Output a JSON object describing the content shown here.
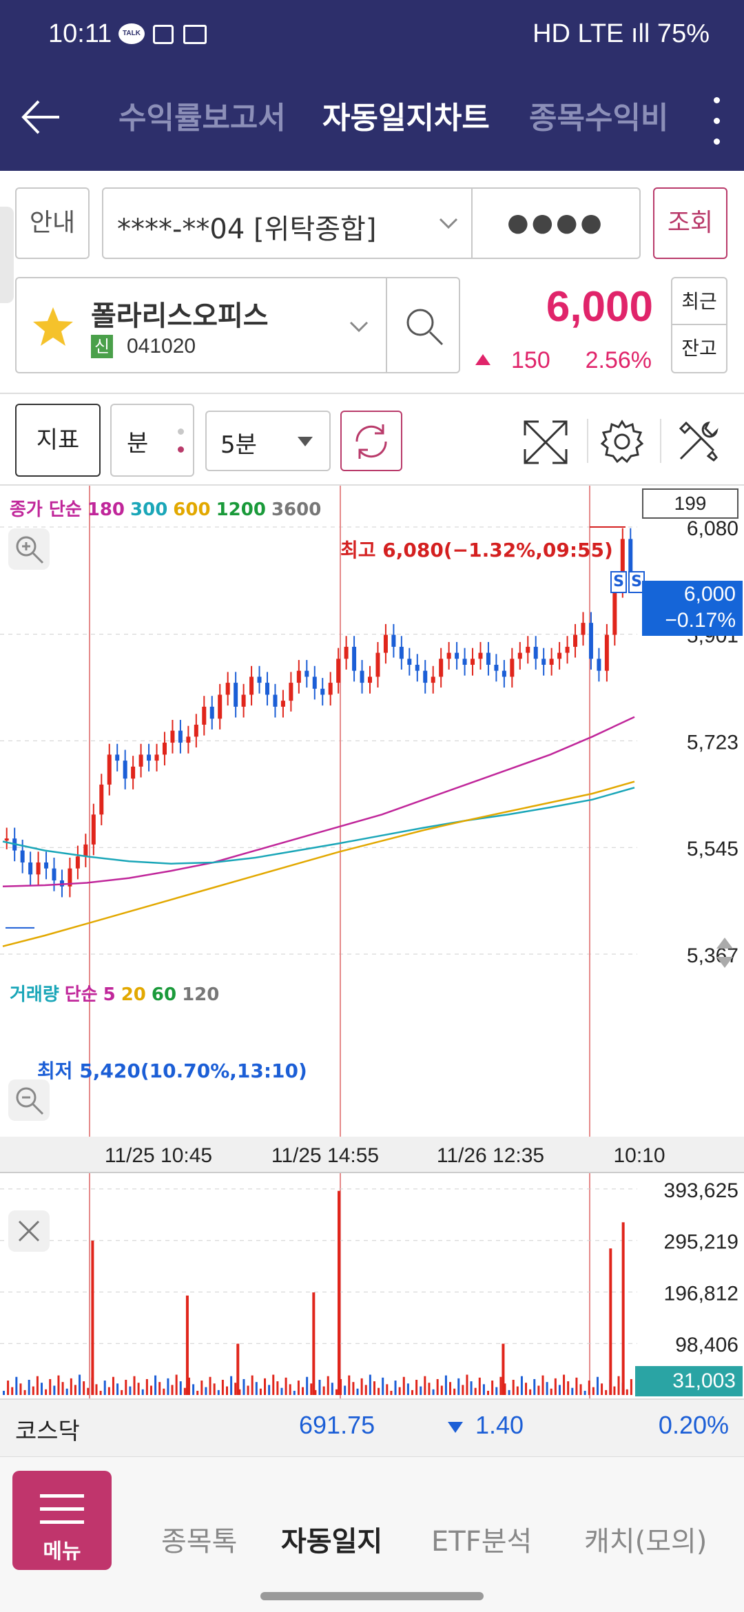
{
  "status_bar": {
    "time": "10:11",
    "right": "HD LTE ıll 75%",
    "battery": "75%"
  },
  "app_bar": {
    "tabs": [
      {
        "label": "수익률보고서",
        "active": false
      },
      {
        "label": "자동일지차트",
        "active": true
      },
      {
        "label": "종목수익비",
        "active": false
      }
    ]
  },
  "form": {
    "guide_label": "안내",
    "account": "****-**04 [위탁종합]",
    "password": "●●●●",
    "query_label": "조회",
    "stock_name": "폴라리스오피스",
    "stock_tag": "신",
    "stock_code": "041020",
    "recent_label": "최근",
    "balance_label": "잔고",
    "price": "6,000",
    "change": "150",
    "change_pct": "2.56%"
  },
  "toolbar": {
    "indicator_label": "지표",
    "minute_label": "분",
    "interval": "5분"
  },
  "chart_meta": {
    "legend": [
      {
        "text": "종가 단순",
        "color": "#c0269a"
      },
      {
        "text": "180",
        "color": "#c0269a"
      },
      {
        "text": "300",
        "color": "#1aa6b8"
      },
      {
        "text": "600",
        "color": "#e2a800"
      },
      {
        "text": "1200",
        "color": "#1a9a3a"
      },
      {
        "text": "3600",
        "color": "#777777"
      }
    ],
    "count_box": "199",
    "high_label": "최고 6,080(−1.32%,09:55)",
    "low_label": "최저 5,420(10.70%,13:10)",
    "price_tag_line1": "6,000",
    "price_tag_line2": "−0.17%",
    "signal_marker": "S",
    "x_labels": [
      "11/25 10:45",
      "11/25 14:55",
      "11/26 12:35",
      "10:10"
    ],
    "vol_legend": [
      {
        "text": "거래량",
        "color": "#1aa6b8"
      },
      {
        "text": "단순",
        "color": "#c0269a"
      },
      {
        "text": "5",
        "color": "#c0269a"
      },
      {
        "text": "20",
        "color": "#e2a800"
      },
      {
        "text": "60",
        "color": "#1a9a3a"
      },
      {
        "text": "120",
        "color": "#777777"
      }
    ],
    "vol_axis": [
      "393,625",
      "295,219",
      "196,812",
      "98,406"
    ],
    "vol_current": "31,003",
    "colors": {
      "up": "#e0251b",
      "down": "#1b5ed6",
      "session_line": "#e58a8a",
      "tag_blue": "#1565d8",
      "tag_teal": "#2aa4a4"
    }
  },
  "chart_data": {
    "type": "candlestick",
    "y_ticks": [
      6080,
      5901,
      5723,
      5545,
      5367
    ],
    "ylim": [
      5367,
      6080
    ],
    "high": 6080,
    "low": 5420,
    "current": 6000,
    "price_series": [
      5560,
      5540,
      5520,
      5500,
      5520,
      5510,
      5490,
      5480,
      5510,
      5530,
      5550,
      5600,
      5650,
      5700,
      5690,
      5660,
      5680,
      5700,
      5690,
      5700,
      5720,
      5740,
      5720,
      5730,
      5750,
      5780,
      5760,
      5800,
      5820,
      5780,
      5800,
      5830,
      5820,
      5800,
      5780,
      5790,
      5820,
      5840,
      5830,
      5810,
      5800,
      5820,
      5860,
      5880,
      5840,
      5820,
      5830,
      5870,
      5900,
      5880,
      5860,
      5850,
      5840,
      5820,
      5830,
      5860,
      5870,
      5860,
      5850,
      5860,
      5870,
      5850,
      5840,
      5830,
      5860,
      5870,
      5880,
      5860,
      5850,
      5860,
      5870,
      5880,
      5900,
      5920,
      5860,
      5840,
      5900,
      5980,
      6060,
      6000
    ],
    "ma_series": [
      {
        "name": "180",
        "color": "#c0269a",
        "values": [
          5480,
          5482,
          5486,
          5494,
          5506,
          5520,
          5540,
          5560,
          5580,
          5600,
          5625,
          5650,
          5675,
          5700,
          5730,
          5763
        ]
      },
      {
        "name": "300",
        "color": "#1aa6b8",
        "values": [
          5555,
          5540,
          5530,
          5522,
          5518,
          5520,
          5528,
          5540,
          5552,
          5565,
          5578,
          5590,
          5600,
          5612,
          5625,
          5645
        ]
      },
      {
        "name": "600",
        "color": "#e2a800",
        "values": [
          5380,
          5398,
          5418,
          5438,
          5458,
          5478,
          5498,
          5518,
          5538,
          5556,
          5574,
          5590,
          5605,
          5620,
          5635,
          5655
        ]
      }
    ],
    "volume": {
      "axis_ticks": [
        393625,
        295219,
        196812,
        98406
      ],
      "current": 31003,
      "spikes": [
        {
          "pos": 0.14,
          "value": 295000
        },
        {
          "pos": 0.29,
          "value": 190000
        },
        {
          "pos": 0.37,
          "value": 98000
        },
        {
          "pos": 0.49,
          "value": 196000
        },
        {
          "pos": 0.53,
          "value": 390000
        },
        {
          "pos": 0.79,
          "value": 98000
        },
        {
          "pos": 0.96,
          "value": 280000
        },
        {
          "pos": 0.98,
          "value": 330000
        }
      ]
    }
  },
  "kosdaq": {
    "name": "코스닥",
    "value": "691.75",
    "change": "1.40",
    "pct": "0.20%"
  },
  "bottom_nav": {
    "menu_label": "메뉴",
    "items": [
      {
        "label": "종목톡",
        "active": false
      },
      {
        "label": "자동일지",
        "active": true
      },
      {
        "label": "ETF분석",
        "active": false
      },
      {
        "label": "캐치(모의)",
        "active": false
      }
    ]
  }
}
